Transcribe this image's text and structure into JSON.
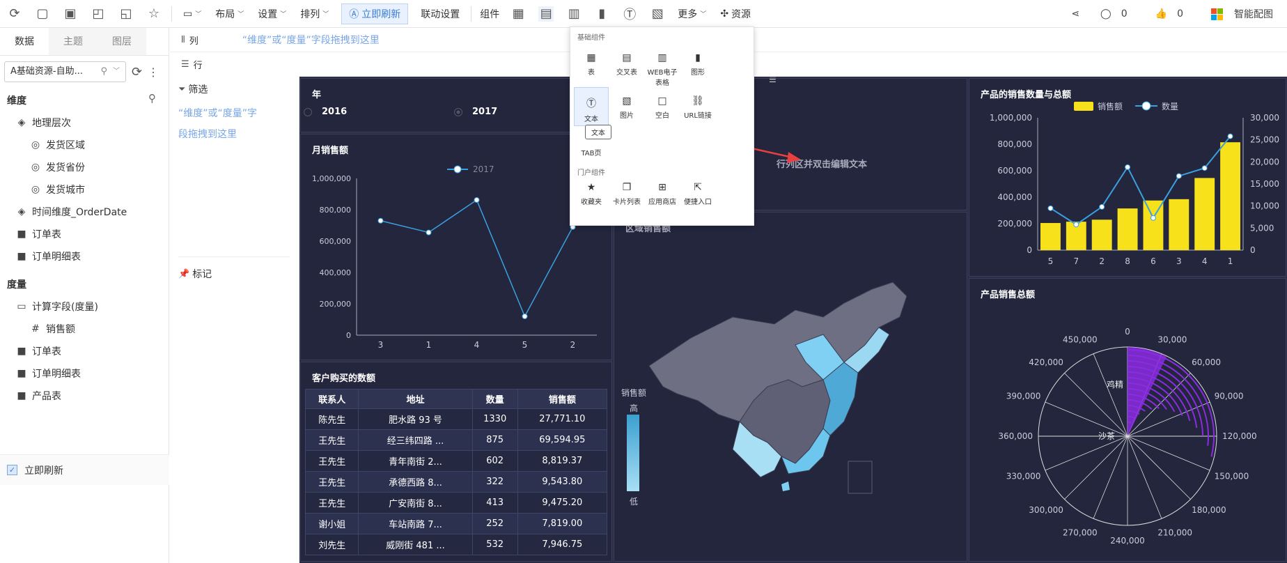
{
  "toolbar": {
    "layout": "布局",
    "settings": "设置",
    "arrange": "排列",
    "refresh_now": "立即刷新",
    "linkage": "联动设置",
    "components": "组件",
    "more": "更多",
    "resources": "资源",
    "comments": "0",
    "likes": "0",
    "smart_chart": "智能配图"
  },
  "left": {
    "tabs": [
      "数据",
      "主题",
      "图层"
    ],
    "datasource": "A基础资源-自助...",
    "dimension_title": "维度",
    "dimensions": [
      {
        "label": "地理层次",
        "indent": 1,
        "icon": "layers-icon"
      },
      {
        "label": "发货区域",
        "indent": 2,
        "icon": "globe-icon"
      },
      {
        "label": "发货省份",
        "indent": 2,
        "icon": "globe-icon"
      },
      {
        "label": "发货城市",
        "indent": 2,
        "icon": "globe-icon"
      },
      {
        "label": "时间维度_OrderDate",
        "indent": 1,
        "icon": "layers-icon"
      },
      {
        "label": "订单表",
        "indent": 1,
        "icon": "folder-icon"
      },
      {
        "label": "订单明细表",
        "indent": 1,
        "icon": "folder-icon"
      }
    ],
    "measure_title": "度量",
    "measures": [
      {
        "label": "计算字段(度量)",
        "indent": 1,
        "icon": "folder-open-icon"
      },
      {
        "label": "销售额",
        "indent": 2,
        "icon": "hash-icon"
      },
      {
        "label": "订单表",
        "indent": 1,
        "icon": "folder-icon"
      },
      {
        "label": "订单明细表",
        "indent": 1,
        "icon": "folder-icon"
      },
      {
        "label": "产品表",
        "indent": 1,
        "icon": "folder-icon"
      }
    ],
    "auto_refresh": "立即刷新"
  },
  "shelf": {
    "column_label": "列",
    "row_label": "行",
    "drop_hint": "“维度”或“度量”字段拖拽到这里",
    "filter_label": "筛选",
    "filter_hint_1": "“维度”或“度量”字",
    "filter_hint_2": "段拖拽到这里",
    "mark_label": "标记"
  },
  "popup": {
    "basic_title": "基础组件",
    "basic_items": [
      "表",
      "交叉表",
      "WEB电子表格",
      "图形",
      "文本",
      "图片",
      "空白",
      "URL链接"
    ],
    "tooltip": "文本",
    "tab_item": "TAB页",
    "portal_title": "门户组件",
    "portal_items": [
      "收藏夹",
      "卡片列表",
      "应用商店",
      "便捷入口"
    ]
  },
  "dashboard": {
    "year_title": "年",
    "year_options": [
      "2016",
      "2017"
    ],
    "text_placeholder": "行列区并双击编辑文本",
    "region_title": "区域销售额",
    "map_legend_title": "销售额",
    "map_legend_high": "高",
    "map_legend_low": "低",
    "monthly_title": "月销售额",
    "customer_title": "客户购买的数额",
    "product_combo_title": "产品的销售数量与总额",
    "product_total_title": "产品销售总额"
  },
  "customer_table": {
    "headers": [
      "联系人",
      "地址",
      "数量",
      "销售额"
    ],
    "rows": [
      [
        "陈先生",
        "肥水路 93 号",
        "1330",
        "27,771.10"
      ],
      [
        "王先生",
        "经三纬四路 ...",
        "875",
        "69,594.95"
      ],
      [
        "王先生",
        "青年南街 2...",
        "602",
        "8,819.37"
      ],
      [
        "王先生",
        "承德西路 8...",
        "322",
        "9,543.80"
      ],
      [
        "王先生",
        "广安南街 8...",
        "413",
        "9,475.20"
      ],
      [
        "谢小姐",
        "车站南路 7...",
        "252",
        "7,819.00"
      ],
      [
        "刘先生",
        "威刚街 481 ...",
        "532",
        "7,946.75"
      ]
    ]
  },
  "chart_data": [
    {
      "type": "line",
      "title": "月销售额",
      "categories": [
        "3",
        "1",
        "4",
        "5",
        "2"
      ],
      "series": [
        {
          "name": "2017",
          "values": [
            730000,
            655000,
            862000,
            120000,
            690000
          ]
        }
      ],
      "ylim": [
        0,
        1000000
      ],
      "yticks": [
        "1,000,000",
        "800,000",
        "600,000",
        "400,000",
        "200,000",
        "0"
      ],
      "color": "#3aa0e0"
    },
    {
      "type": "bar",
      "title": "产品的销售数量与总额",
      "categories": [
        "5",
        "7",
        "2",
        "8",
        "6",
        "3",
        "4",
        "1"
      ],
      "series": [
        {
          "name": "销售额",
          "values": [
            205000,
            215000,
            230000,
            315000,
            375000,
            385000,
            545000,
            815000
          ],
          "color": "#f7e11a"
        },
        {
          "name": "数量",
          "values": [
            9500,
            5800,
            9800,
            18800,
            7300,
            16800,
            18600,
            25800
          ],
          "color": "#3aa0e0"
        }
      ],
      "ylim": [
        0,
        1000000
      ],
      "y2lim": [
        0,
        30000
      ],
      "yticks": [
        "1,000,000",
        "800,000",
        "600,000",
        "400,000",
        "200,000",
        "0"
      ],
      "y2ticks": [
        "30,000",
        "25,000",
        "20,000",
        "15,000",
        "10,000",
        "5,000",
        "0"
      ]
    },
    {
      "type": "polar",
      "title": "产品销售总额",
      "angle_ticks": [
        "0",
        "30,000",
        "60,000",
        "90,000",
        "120,000",
        "150,000",
        "180,000",
        "210,000",
        "240,000",
        "270,000",
        "300,000",
        "330,000",
        "360,000",
        "390,000",
        "420,000",
        "450,000"
      ],
      "category_labels": [
        "鸡精",
        "沙茶"
      ],
      "color": "#8a2be2"
    }
  ]
}
